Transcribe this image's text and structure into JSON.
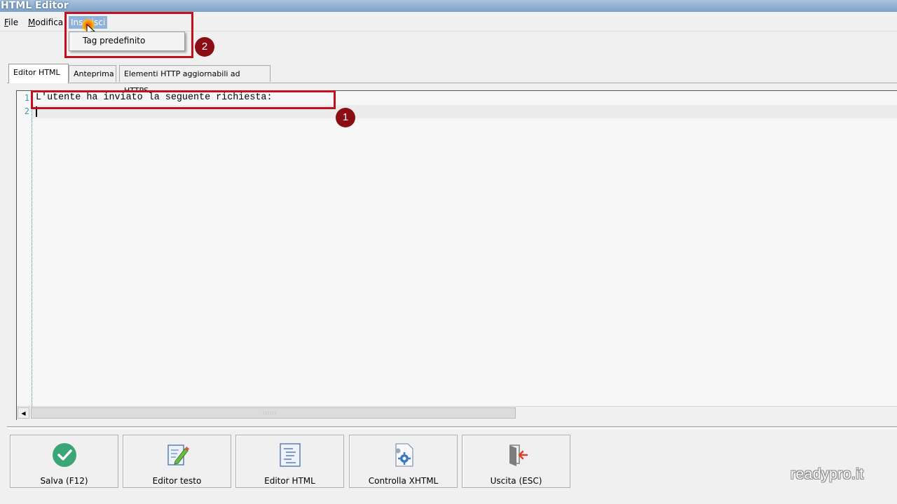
{
  "window": {
    "title": "HTML Editor"
  },
  "menu": {
    "file": "File",
    "modifica": "Modifica",
    "inserisci": "Inserisci"
  },
  "dropdown": {
    "items": [
      "Tag predefinito"
    ]
  },
  "annotations": {
    "badge1": "1",
    "badge2": "2",
    "highlight_color": "#c0111f",
    "badge_color": "#8b0e14"
  },
  "tabs": [
    "Editor HTML",
    "Anteprima",
    "Elementi HTTP aggiornabili ad HTTPS"
  ],
  "editor": {
    "line_numbers": [
      "1",
      "2"
    ],
    "lines": [
      "L'utente ha inviato la seguente richiesta:",
      ""
    ]
  },
  "buttons": {
    "save": {
      "label": "Salva (F12)",
      "icon": "check-circle-icon"
    },
    "text_editor": {
      "label": "Editor testo",
      "icon": "edit-document-icon"
    },
    "html_editor": {
      "label": "Editor HTML",
      "icon": "html-document-icon"
    },
    "check_xhtml": {
      "label": "Controlla XHTML",
      "icon": "gear-document-icon"
    },
    "exit": {
      "label": "Uscita (ESC)",
      "icon": "exit-door-icon"
    }
  },
  "brand": "readypro.it"
}
